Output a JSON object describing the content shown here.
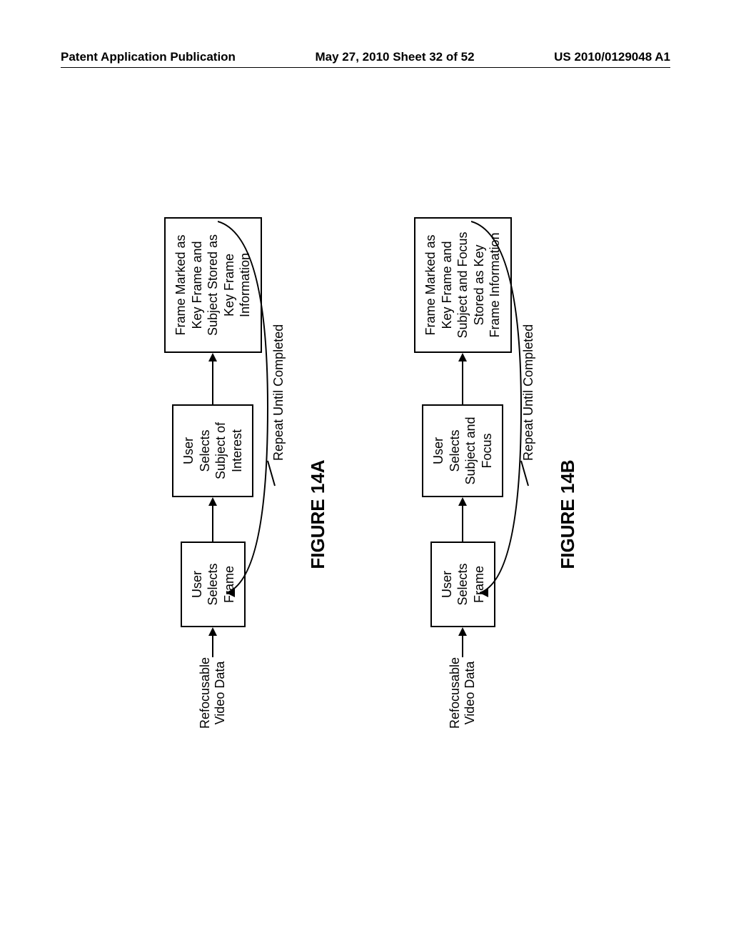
{
  "header": {
    "left": "Patent Application Publication",
    "center": "May 27, 2010  Sheet 32 of 52",
    "right": "US 2010/0129048 A1"
  },
  "figure_a": {
    "input": "Refocusable Video Data",
    "box1": "User Selects Frame",
    "box2": "User Selects Subject of Interest",
    "box3": "Frame Marked as Key Frame and Subject Stored as Key Frame Information",
    "repeat": "Repeat Until Completed",
    "label": "FIGURE 14A"
  },
  "figure_b": {
    "input": "Refocusable Video Data",
    "box1": "User Selects Frame",
    "box2": "User Selects Subject and Focus",
    "box3": "Frame Marked as Key Frame and Subject and Focus Stored as Key Frame Information",
    "repeat": "Repeat Until Completed",
    "label": "FIGURE 14B"
  }
}
